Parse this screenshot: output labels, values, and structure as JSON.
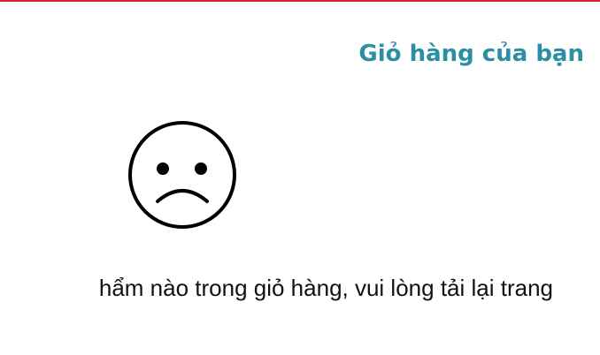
{
  "header": {
    "accent_color": "#d9232e"
  },
  "cart": {
    "title": "Giỏ hàng của bạn",
    "title_color": "#2a8fa2",
    "empty_icon": "sad-face-icon",
    "empty_message": "hẩm nào trong giỏ hàng, vui lòng tải lại trang"
  }
}
